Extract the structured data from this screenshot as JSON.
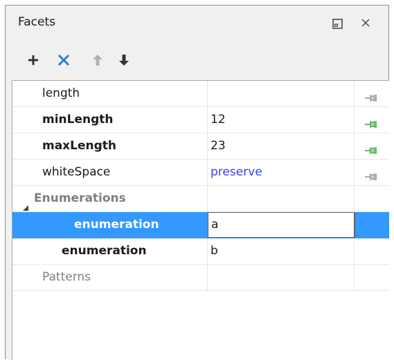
{
  "window": {
    "title": "Facets",
    "restore_icon": "restore-icon",
    "close_icon": "close-icon"
  },
  "toolbar": {
    "buttons": [
      {
        "name": "add",
        "icon": "plus-icon"
      },
      {
        "name": "remove",
        "icon": "x-icon"
      },
      {
        "name": "move-up",
        "icon": "arrow-up-icon"
      },
      {
        "name": "move-down",
        "icon": "arrow-down-icon"
      }
    ]
  },
  "grid": {
    "rows": [
      {
        "name": "length",
        "value": "",
        "bold": false,
        "pin": "grey-pin"
      },
      {
        "name": "minLength",
        "value": "12",
        "bold": true,
        "pin": "green-pin"
      },
      {
        "name": "maxLength",
        "value": "23",
        "bold": true,
        "pin": "green-pin"
      },
      {
        "name": "whiteSpace",
        "value": "preserve",
        "bold": false,
        "pin": "grey-pin"
      },
      {
        "name": "Enumerations",
        "value": "",
        "bold": true,
        "group": true,
        "expanded": true
      },
      {
        "name": "enumeration",
        "value": "a",
        "bold": true,
        "selected": true
      },
      {
        "name": "enumeration",
        "value": "b",
        "bold": true
      },
      {
        "name": "Patterns",
        "value": "",
        "bold": false
      }
    ]
  },
  "colors": {
    "selection": "#3399ff",
    "link_value": "#3c3cf0",
    "remove_icon": "#2b7bd6",
    "pin_green": "#4caf50",
    "pin_grey": "#8a8a8a"
  }
}
